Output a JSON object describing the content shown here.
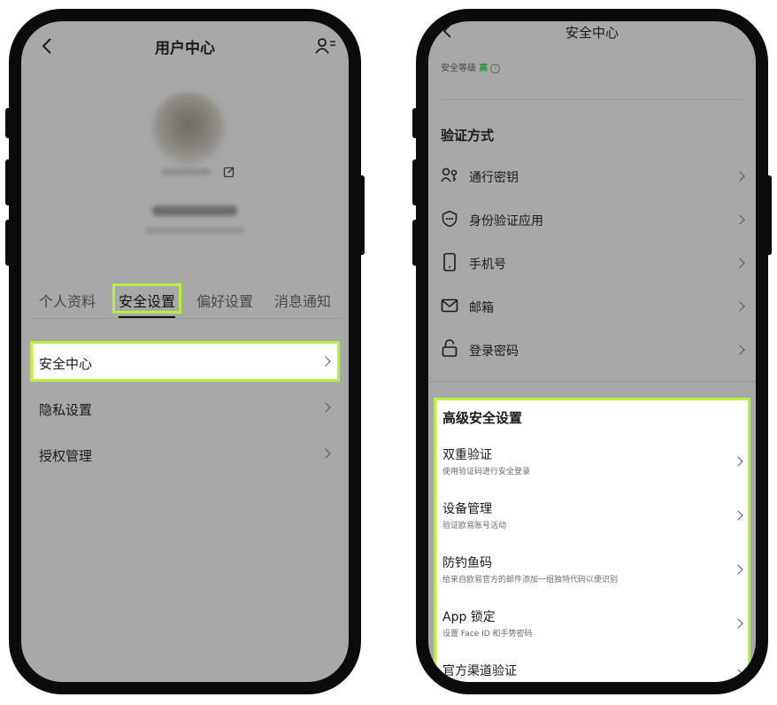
{
  "left": {
    "header_title": "用户中心",
    "tabs": [
      "个人资料",
      "安全设置",
      "偏好设置",
      "消息通知"
    ],
    "active_tab_index": 1,
    "menu": [
      "安全中心",
      "隐私设置",
      "授权管理"
    ]
  },
  "right": {
    "header_title": "安全中心",
    "security_level_label": "安全等级",
    "security_level_value": "高",
    "verify_section_title": "验证方式",
    "verify_items": [
      "通行密钥",
      "身份验证应用",
      "手机号",
      "邮箱",
      "登录密码"
    ],
    "advanced_title": "高级安全设置",
    "advanced_items": [
      {
        "title": "双重验证",
        "subtitle": "使用验证码进行安全登录"
      },
      {
        "title": "设备管理",
        "subtitle": "验证欧易账号活动"
      },
      {
        "title": "防钓鱼码",
        "subtitle": "给来自欧易官方的邮件添加一组独特代码以便识别"
      },
      {
        "title": "App 锁定",
        "subtitle": "设置 Face ID 和手势密码"
      },
      {
        "title": "官方渠道验证",
        "subtitle": ""
      }
    ]
  },
  "colors": {
    "highlight": "#b5f03c",
    "level_green": "#1f9d3a",
    "screen_bg": "#a8a8a8"
  }
}
